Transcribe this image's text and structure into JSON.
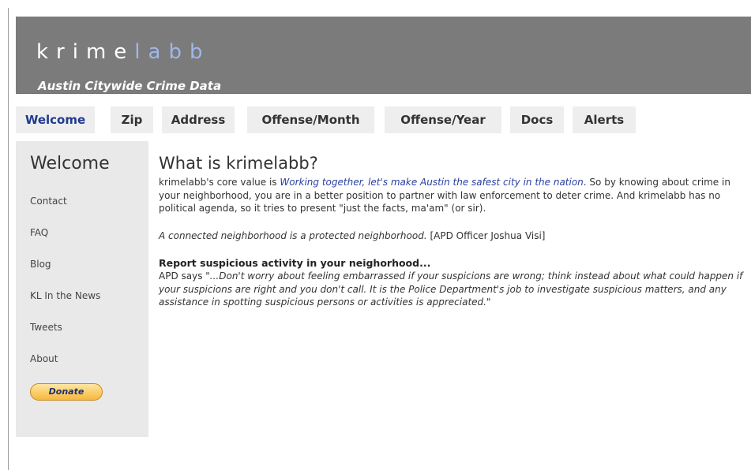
{
  "header": {
    "logo_part1": "krime",
    "logo_part2": "labb",
    "tagline": "Austin Citywide Crime Data"
  },
  "nav": {
    "tabs": [
      {
        "label": "Welcome",
        "active": true
      },
      {
        "label": "Zip"
      },
      {
        "label": "Address"
      },
      {
        "label": "Offense/Month"
      },
      {
        "label": "Offense/Year"
      },
      {
        "label": "Docs"
      },
      {
        "label": "Alerts"
      }
    ]
  },
  "sidebar": {
    "title": "Welcome",
    "links": [
      "Contact",
      "FAQ",
      "Blog",
      "KL In the News",
      "Tweets",
      "About"
    ],
    "donate_label": "Donate"
  },
  "main": {
    "title": "What is krimelabb?",
    "intro_pre": "krimelabb's core value is ",
    "intro_highlight": "Working together, let's make Austin the safest city in the nation",
    "intro_post": ". So by knowing about crime in your neighborhood, you are in a better position to partner with law enforcement to deter crime. And krimelabb has no political agenda, so it tries to present \"just the facts, ma'am\" (or sir).",
    "quote_text": "A connected neighborhood is a protected neighborhood.",
    "quote_attribution": " [APD Officer Joshua Visi]",
    "report_heading": "Report suspicious activity in your neighorhood...",
    "report_prefix": "APD says ",
    "report_quote": "\"...Don't worry about feeling embarrassed if your suspicions are wrong; think instead about what could happen if your suspicions are right and you don't call. It is the Police Department's job to investigate suspicious matters, and any assistance in spotting suspicious persons or activities is appreciated.\""
  },
  "colors": {
    "header_bg": "#7b7b7b",
    "logo_accent": "#9fb7e8",
    "active_tab": "#213a8f",
    "tab_bg": "#eeeeee",
    "sidebar_bg": "#e9e9e9",
    "highlight_text": "#2a3f9f",
    "donate_button": "#f6b93c"
  }
}
